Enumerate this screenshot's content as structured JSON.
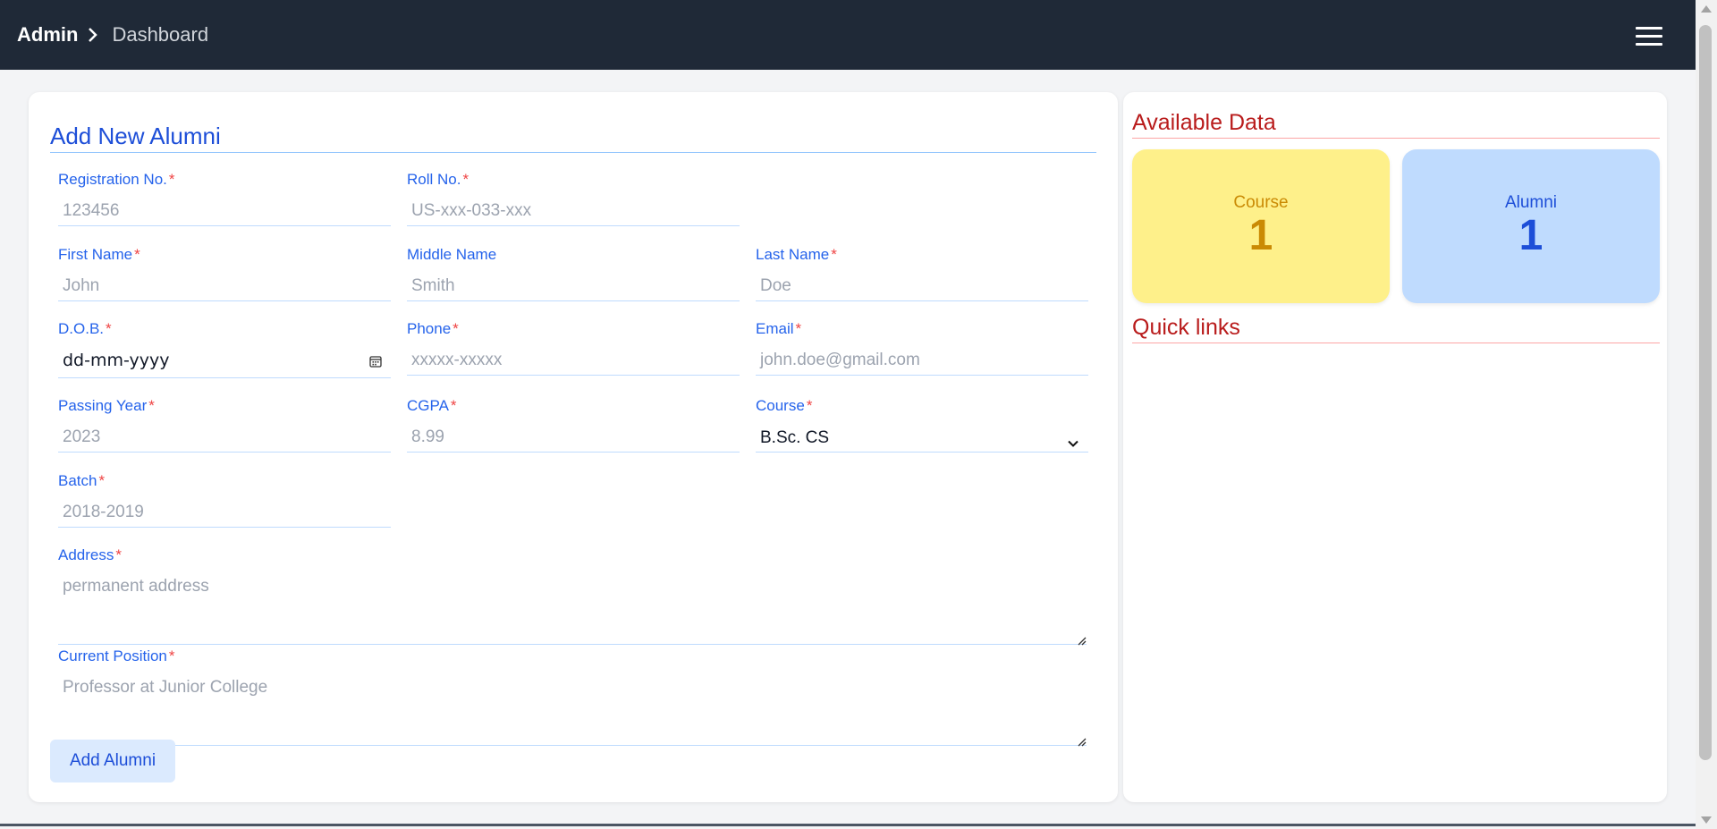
{
  "header": {
    "breadcrumb_root": "Admin",
    "breadcrumb_current": "Dashboard",
    "menu_icon": "hamburger-menu-icon"
  },
  "form": {
    "title": "Add New Alumni",
    "required_marker": "*",
    "fields": {
      "registration_no": {
        "label": "Registration No.",
        "placeholder": "123456"
      },
      "roll_no": {
        "label": "Roll No.",
        "placeholder": "US-xxx-033-xxx"
      },
      "first_name": {
        "label": "First Name",
        "placeholder": "John"
      },
      "middle_name": {
        "label": "Middle Name",
        "placeholder": "Smith"
      },
      "last_name": {
        "label": "Last Name",
        "placeholder": "Doe"
      },
      "dob": {
        "label": "D.O.B.",
        "value": "dd-mm-yyyy"
      },
      "phone": {
        "label": "Phone",
        "placeholder": "xxxxx-xxxxx"
      },
      "email": {
        "label": "Email",
        "placeholder": "john.doe@gmail.com"
      },
      "passing_year": {
        "label": "Passing Year",
        "placeholder": "2023"
      },
      "cgpa": {
        "label": "CGPA",
        "placeholder": "8.99"
      },
      "course": {
        "label": "Course",
        "value": "B.Sc. CS"
      },
      "batch": {
        "label": "Batch",
        "placeholder": "2018-2019"
      },
      "address": {
        "label": "Address",
        "placeholder": "permanent address"
      },
      "current_position": {
        "label": "Current Position",
        "placeholder": "Professor at Junior College"
      }
    },
    "submit_label": "Add Alumni"
  },
  "sidebar": {
    "available_title": "Available Data",
    "stats": [
      {
        "label": "Course",
        "value": "1",
        "color": "#ca8a04",
        "bg": "#fef08a"
      },
      {
        "label": "Alumni",
        "value": "1",
        "color": "#1d4ed8",
        "bg": "#bfdbfe"
      }
    ],
    "quick_links_title": "Quick links"
  },
  "colors": {
    "topbar": "#1f2937",
    "label": "#2563eb",
    "required": "#ef4444",
    "side_title": "#b91c1c"
  }
}
